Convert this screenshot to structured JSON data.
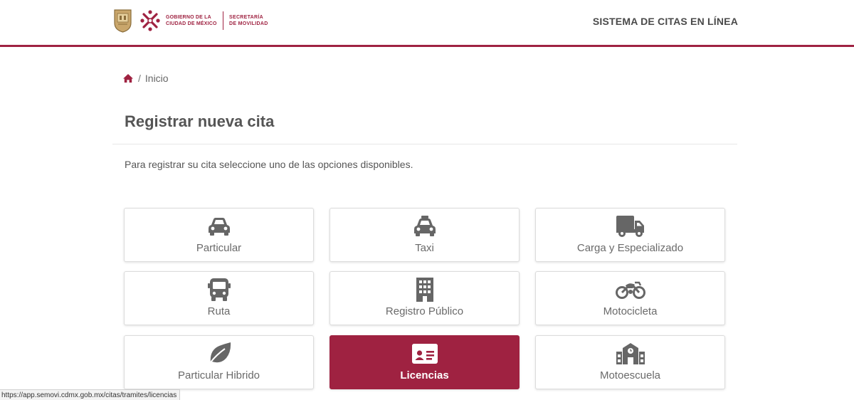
{
  "header": {
    "gov_line1": "GOBIERNO DE LA",
    "gov_line2": "CIUDAD DE MÉXICO",
    "sec_line1": "SECRETARÍA",
    "sec_line2": "DE MOVILIDAD",
    "system_title": "SISTEMA DE CITAS EN LÍNEA",
    "accent_color": "#9f2241"
  },
  "breadcrumb": {
    "separator": "/",
    "current": "Inicio"
  },
  "page": {
    "title": "Registrar nueva cita",
    "intro": "Para registrar su cita seleccione uno de las opciones disponibles."
  },
  "options": [
    {
      "label": "Particular",
      "icon": "car-icon"
    },
    {
      "label": "Taxi",
      "icon": "taxi-icon"
    },
    {
      "label": "Carga y Especializado",
      "icon": "truck-icon"
    },
    {
      "label": "Ruta",
      "icon": "bus-icon"
    },
    {
      "label": "Registro Público",
      "icon": "building-icon"
    },
    {
      "label": "Motocicleta",
      "icon": "motorcycle-icon"
    },
    {
      "label": "Particular Hibrido",
      "icon": "leaf-icon"
    },
    {
      "label": "Licencias",
      "icon": "id-card-icon",
      "selected": true
    },
    {
      "label": "Motoescuela",
      "icon": "school-icon"
    }
  ],
  "status_bar": {
    "url": "https://app.semovi.cdmx.gob.mx/citas/tramites/licencias"
  }
}
